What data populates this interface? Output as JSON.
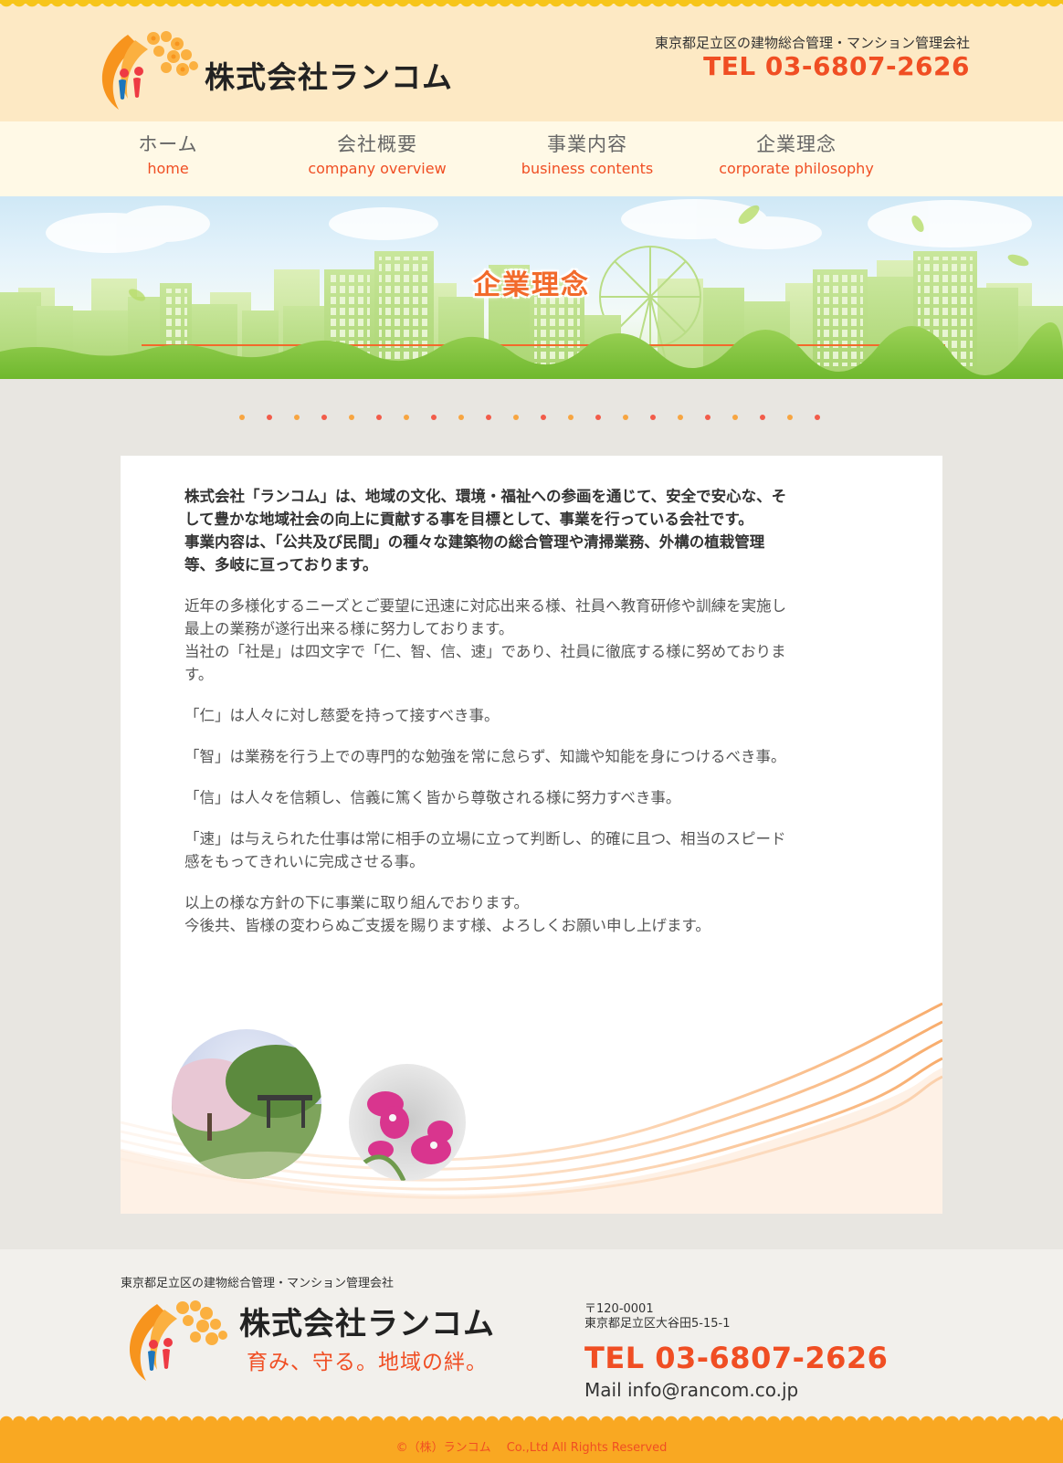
{
  "header": {
    "company_name": "株式会社ランコム",
    "tagline": "東京都足立区の建物総合管理・マンション管理会社",
    "tel": "TEL 03-6807-2626"
  },
  "nav": [
    {
      "jp": "ホーム",
      "en": "home"
    },
    {
      "jp": "会社概要",
      "en": "company overview"
    },
    {
      "jp": "事業内容",
      "en": "business contents"
    },
    {
      "jp": "企業理念",
      "en": "corporate philosophy"
    }
  ],
  "hero": {
    "title": "企業理念"
  },
  "content": {
    "lead": "株式会社「ランコム」は、地域の文化、環境・福祉への参画を通じて、安全で安心な、そして豊かな地域社会の向上に貢献する事を目標として、事業を行っている会社です。",
    "lead2": "事業内容は、「公共及び民間」の種々な建築物の総合管理や清掃業務、外構の植栽管理等、多岐に亘っております。",
    "p1a": "近年の多様化するニーズとご要望に迅速に対応出来る様、社員へ教育研修や訓練を実施し最上の業務が遂行出来る様に努力しております。",
    "p1b": "当社の「社是」は四文字で「仁、智、信、速」であり、社員に徹底する様に努めております。",
    "p2": "「仁」は人々に対し慈愛を持って接すべき事。",
    "p3": "「智」は業務を行う上での専門的な勉強を常に怠らず、知識や知能を身につけるべき事。",
    "p4": "「信」は人々を信頼し、信義に篤く皆から尊敬される様に努力すべき事。",
    "p5": "「速」は与えられた仕事は常に相手の立場に立って判断し、的確に且つ、相当のスピード感をもってきれいに完成させる事。",
    "p6a": "以上の様な方針の下に事業に取り組んでおります。",
    "p6b": "今後共、皆様の変わらぬご支援を賜ります様、よろしくお願い申し上げます。"
  },
  "footer": {
    "tagline": "東京都足立区の建物総合管理・マンション管理会社",
    "company_name": "株式会社ランコム",
    "slogan": "育み、守る。地域の絆。",
    "zip": "〒120-0001",
    "address": "東京都足立区大谷田5-15-1",
    "tel": "TEL 03-6807-2626",
    "mail": "Mail info@rancom.co.jp",
    "copyright": "©（株）ランコム　 Co.,Ltd All Rights Reserved"
  },
  "colors": {
    "accent": "#f04e23",
    "header_bg": "#fde9c4",
    "nav_bg": "#fff9e6",
    "footer_band": "#f9a822",
    "dot_orange": "#f7a541",
    "dot_red": "#f25c4a"
  },
  "icons": [
    "company-logo-mark"
  ]
}
